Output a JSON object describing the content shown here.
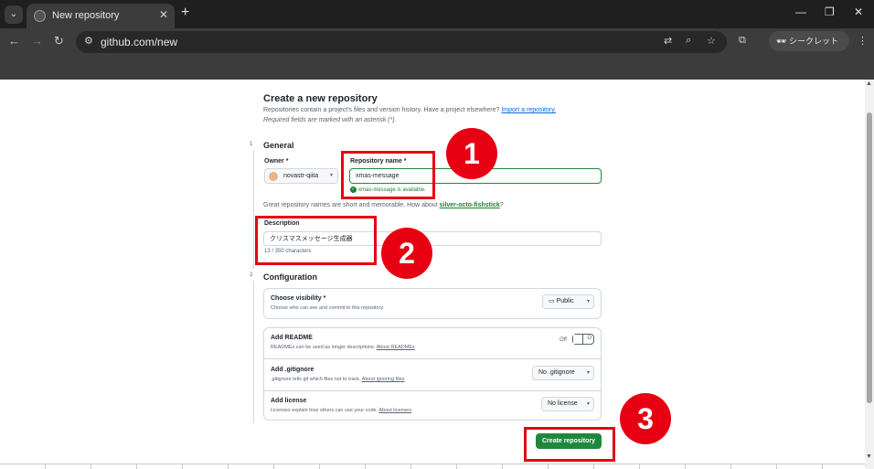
{
  "browser": {
    "tab_title": "New repository",
    "url": "github.com/new",
    "incognito_label": "シークレット"
  },
  "page": {
    "title": "Create a new repository",
    "subtitle": "Repositories contain a project's files and version history. Have a project elsewhere?",
    "import_link": "Import a repository.",
    "required_note": "Required fields are marked with an asterisk (*).",
    "general": {
      "step": "1",
      "title": "General",
      "owner_label": "Owner *",
      "owner_value": "novastr-qiita",
      "separator": "/",
      "repo_label": "Repository name *",
      "repo_value": "xmas-message",
      "availability": "xmas-message is available.",
      "hint_prefix": "Great repository names are short and memorable. How about",
      "hint_suggestion": "silver-octo-fishstick",
      "hint_suffix": "?",
      "description_label": "Description",
      "description_value": "クリスマスメッセージ生成器",
      "char_count": "13 / 350 characters"
    },
    "configuration": {
      "step": "2",
      "title": "Configuration",
      "visibility": {
        "title": "Choose visibility *",
        "desc": "Choose who can see and commit to this repository",
        "value": "Public"
      },
      "readme": {
        "title": "Add README",
        "desc": "READMEs can be used as longer descriptions.",
        "link": "About READMEs",
        "toggle_label": "Off",
        "toggle_state": "O"
      },
      "gitignore": {
        "title": "Add .gitignore",
        "desc": ".gitignore tells git which files not to track.",
        "link": "About ignoring files",
        "value": "No .gitignore"
      },
      "license": {
        "title": "Add license",
        "desc": "Licenses explain how others can use your code.",
        "link": "About licenses",
        "value": "No license"
      }
    },
    "create_button": "Create repository"
  },
  "annotations": {
    "badge_1": "1",
    "badge_2": "2",
    "badge_3": "3",
    "color": "#e60012"
  },
  "icons": [
    "github-favicon",
    "close-icon",
    "plus-icon",
    "back-icon",
    "forward-icon",
    "reload-icon",
    "translate-icon",
    "zoom-icon",
    "star-icon",
    "extensions-icon",
    "incognito-icon",
    "kebab-menu-icon",
    "check-circle-icon",
    "globe-icon"
  ]
}
